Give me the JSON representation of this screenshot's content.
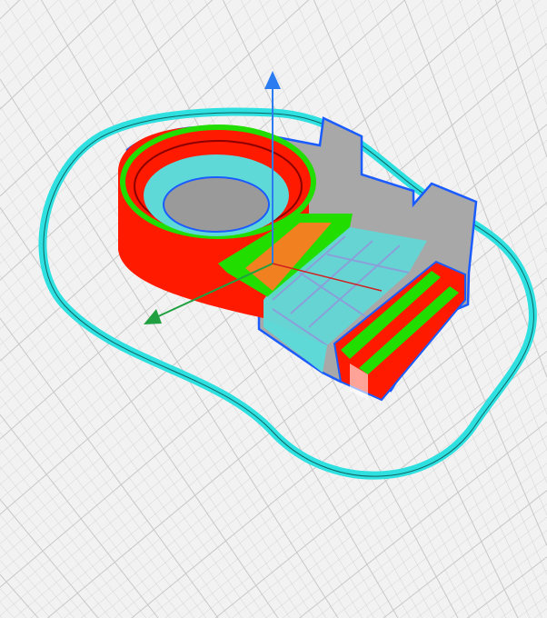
{
  "viewport": {
    "mode": "layer-preview",
    "colors": {
      "background": "#f2f2f2",
      "grid": "#c8c8c8",
      "skirt": "#2ee0e0",
      "wall_outer": "#ff1a00",
      "wall_inner": "#22dd00",
      "infill": "#8aa0d8",
      "support": "#5fd8d8",
      "skin": "#f08020",
      "model_outline": "#1a5cff",
      "base": "#a8a8a8"
    },
    "axes": {
      "z_axis_color": "#2b7cf0",
      "x_axis_color": "#d02020",
      "y_axis_color": "#20a040"
    },
    "icons": [
      "z-axis-arrow-icon",
      "y-axis-arrow-icon"
    ]
  }
}
